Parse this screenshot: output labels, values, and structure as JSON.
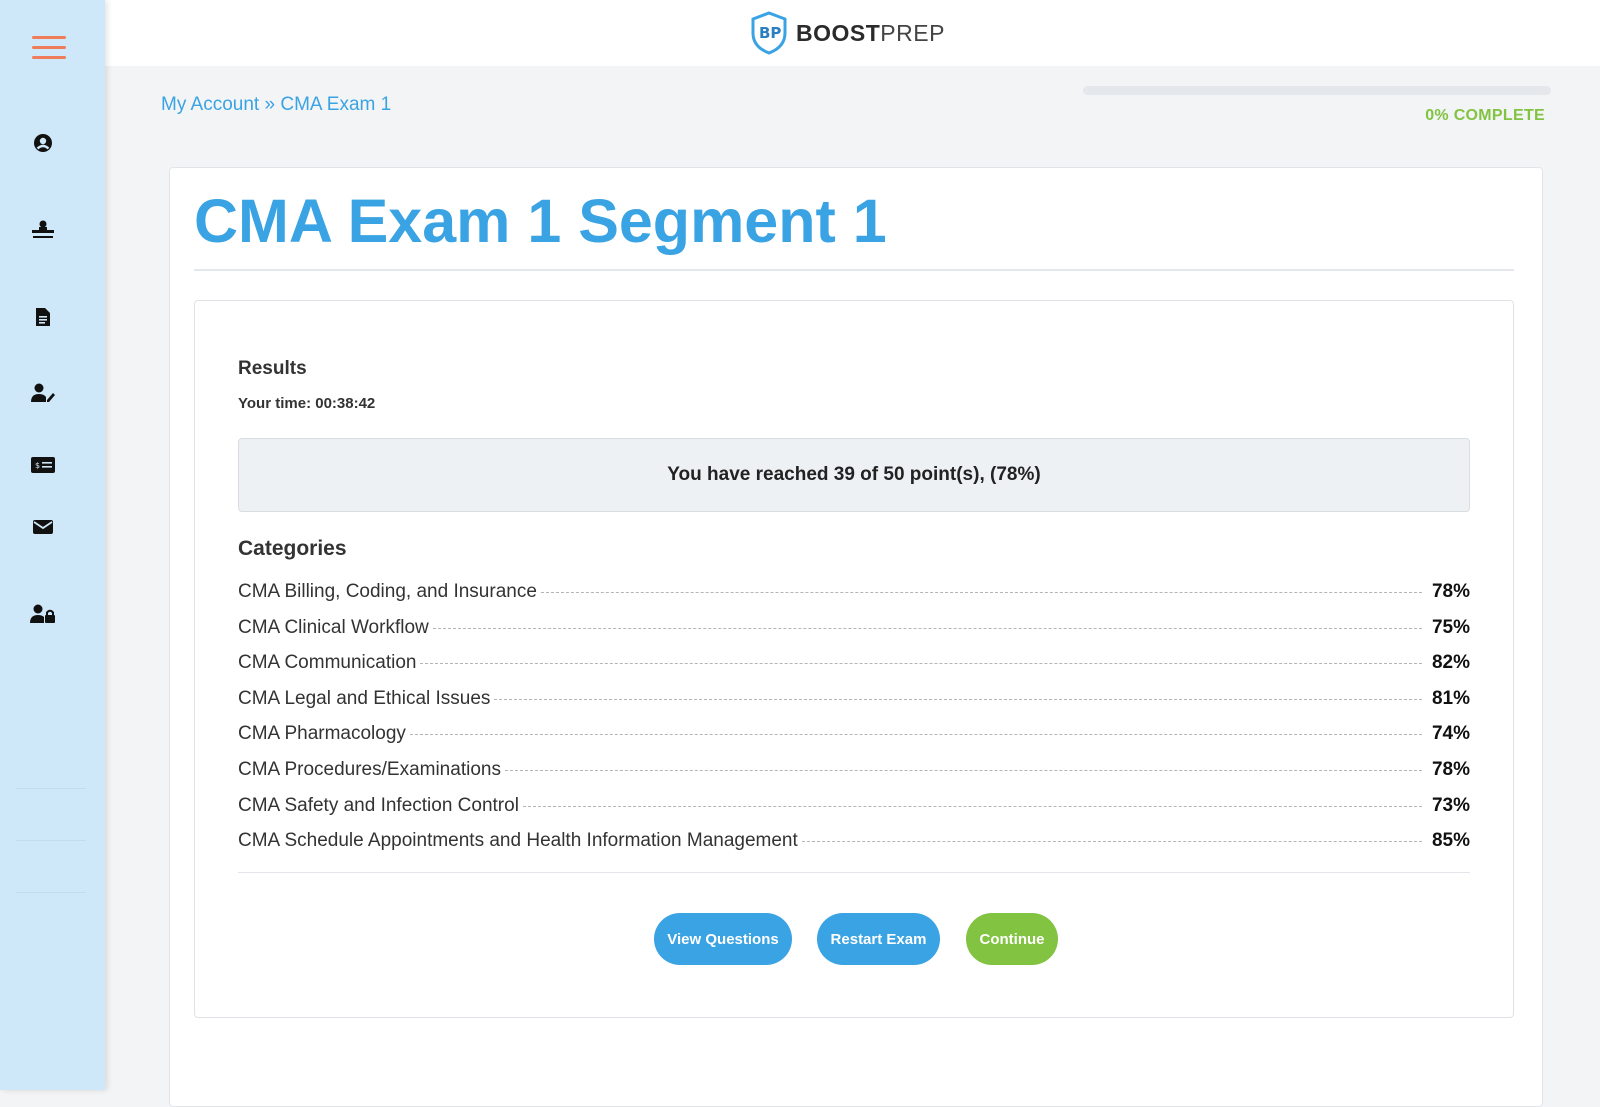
{
  "sidebar": {
    "icons": [
      "menu-icon",
      "account-icon",
      "course-icon",
      "document-icon",
      "user-edit-icon",
      "billing-icon",
      "mail-icon",
      "user-lock-icon"
    ]
  },
  "header": {
    "logo_bold": "BOOST",
    "logo_light": "PREP",
    "brand_colors": {
      "blue": "#3aa3e3",
      "green": "#82c341",
      "orange": "#ef7d5a"
    }
  },
  "breadcrumb": {
    "items": [
      "My Account",
      "CMA Exam 1"
    ],
    "separator": "»"
  },
  "progress": {
    "percent": 0,
    "label": "0% COMPLETE"
  },
  "page": {
    "title": "CMA Exam 1 Segment 1"
  },
  "results": {
    "heading": "Results",
    "time_label": "Your time: 00:38:42",
    "points_text": "You have reached 39 of 50 point(s), (78%)"
  },
  "categories": {
    "heading": "Categories",
    "items": [
      {
        "name": "CMA Billing, Coding, and Insurance",
        "value": "78%"
      },
      {
        "name": "CMA Clinical Workflow",
        "value": "75%"
      },
      {
        "name": "CMA Communication",
        "value": "82%"
      },
      {
        "name": "CMA Legal and Ethical Issues",
        "value": "81%"
      },
      {
        "name": "CMA Pharmacology",
        "value": "74%"
      },
      {
        "name": "CMA Procedures/Examinations",
        "value": "78%"
      },
      {
        "name": "CMA Safety and Infection Control",
        "value": "73%"
      },
      {
        "name": "CMA Schedule Appointments and Health Information Management",
        "value": "85%"
      }
    ]
  },
  "buttons": {
    "view_questions": "View Questions",
    "restart_exam": "Restart Exam",
    "continue": "Continue"
  }
}
